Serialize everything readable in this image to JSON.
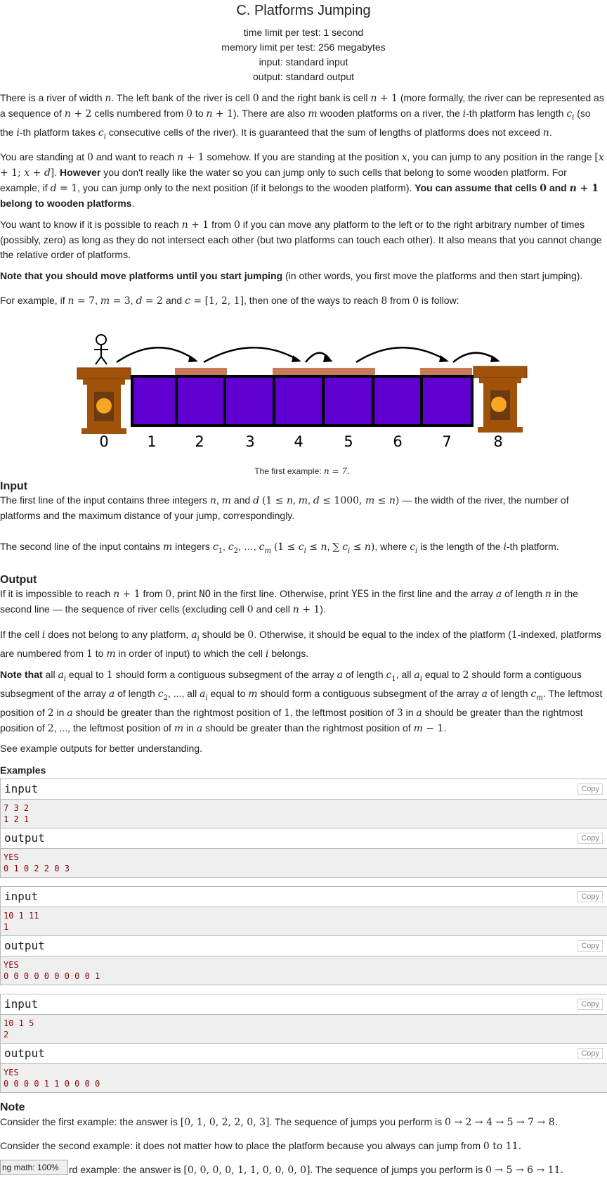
{
  "problem": {
    "title": "C. Platforms Jumping",
    "time_limit": "time limit per test: 1 second",
    "memory_limit": "memory limit per test: 256 megabytes",
    "input_file": "input: standard input",
    "output_file": "output: standard output"
  },
  "figure": {
    "cells": [
      "0",
      "1",
      "2",
      "3",
      "4",
      "5",
      "6",
      "7",
      "8"
    ],
    "caption_prefix": "The first example:",
    "caption_math": "n = 7."
  },
  "sections": {
    "input": "Input",
    "output": "Output",
    "examples": "Examples",
    "note": "Note"
  },
  "examples": [
    {
      "in_label": "input",
      "in": "7 3 2\n1 2 1",
      "out_label": "output",
      "out": "YES\n0 1 0 2 2 0 3",
      "copy": "Copy"
    },
    {
      "in_label": "input",
      "in": "10 1 11\n1",
      "out_label": "output",
      "out": "YES\n0 0 0 0 0 0 0 0 0 1",
      "copy": "Copy"
    },
    {
      "in_label": "input",
      "in": "10 1 5\n2",
      "out_label": "output",
      "out": "YES\n0 0 0 0 1 1 0 0 0 0",
      "copy": "Copy"
    }
  ],
  "note_lines": {
    "n1a": "Consider the first example: the answer is ",
    "n1m": "[0, 1, 0, 2, 2, 0, 3]",
    "n1b": ". The sequence of jumps you perform is ",
    "n1c": "0 → 2 → 4 → 5 → 7 → 8.",
    "n2a": "Consider the second example: it does not matter how to place the platform because you always can jump from ",
    "n2b": "0 to 11.",
    "n3a": "rd example: the answer is ",
    "n3m": "[0, 0, 0, 0, 1, 1, 0, 0, 0, 0]",
    "n3b": ". The sequence of jumps you perform is ",
    "n3c": "0 → 5 → 6 → 11."
  },
  "status_badge": "ng math: 100%"
}
